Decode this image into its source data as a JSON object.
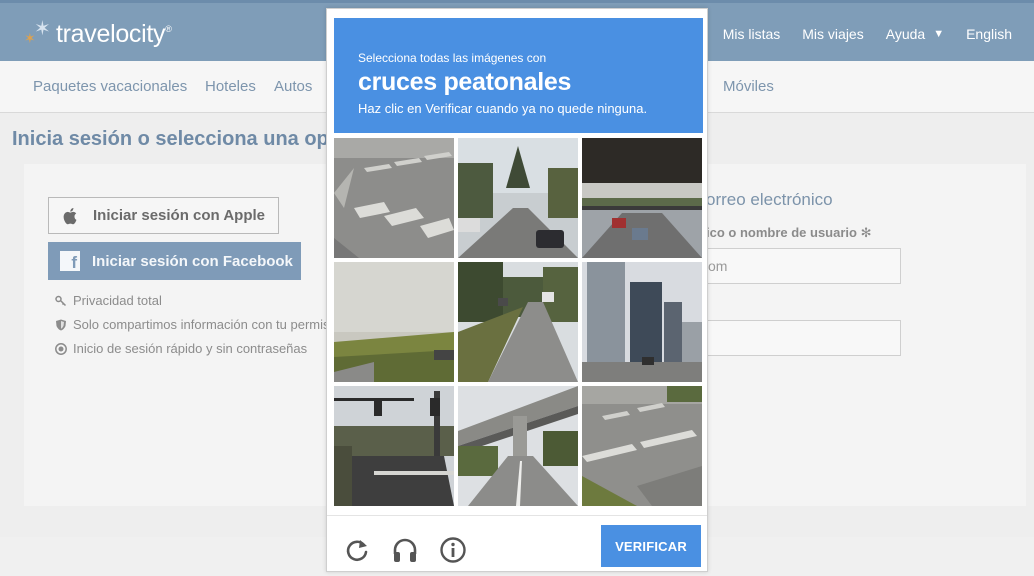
{
  "site": {
    "logo_text": "travelocity",
    "logo_tm": "®"
  },
  "topnav": {
    "items": [
      {
        "label": "Mis listas"
      },
      {
        "label": "Mis viajes"
      },
      {
        "label": "Ayuda"
      },
      {
        "label": "English"
      }
    ]
  },
  "subnav": {
    "items": [
      {
        "label": "Paquetes vacacionales"
      },
      {
        "label": "Hoteles"
      },
      {
        "label": "Autos"
      },
      {
        "label": "Móviles"
      }
    ]
  },
  "page": {
    "heading": "Inicia sesión o selecciona una op",
    "apple_button": "Iniciar sesión con Apple",
    "facebook_button": "Iniciar sesión con Facebook",
    "features": [
      {
        "icon": "key-icon",
        "label": "Privacidad total"
      },
      {
        "icon": "shield-icon",
        "label": "Solo compartimos información con tu permis"
      },
      {
        "icon": "target-icon",
        "label": "Inicio de sesión rápido y sin contraseñas"
      }
    ],
    "right_title": "orreo electrónico",
    "right_label": "ico o nombre de usuario",
    "right_label_required": "✻",
    "email_input_value": "om",
    "password_input_value": ""
  },
  "captcha": {
    "header_line1": "Selecciona todas las imágenes con",
    "header_line2": "cruces peatonales",
    "header_line3": "Haz clic en Verificar cuando ya no quede ninguna.",
    "verify_label": "VERIFICAR",
    "footer_icons": [
      "reload-icon",
      "audio-headphones-icon",
      "info-icon"
    ],
    "tiles": [
      {
        "name": "tile-1",
        "scene": "crosswalk"
      },
      {
        "name": "tile-2",
        "scene": "road-trees-cars"
      },
      {
        "name": "tile-3",
        "scene": "highway-overpass"
      },
      {
        "name": "tile-4",
        "scene": "grass-field"
      },
      {
        "name": "tile-5",
        "scene": "road-trees"
      },
      {
        "name": "tile-6",
        "scene": "city-buildings"
      },
      {
        "name": "tile-7",
        "scene": "traffic-lights-intersection"
      },
      {
        "name": "tile-8",
        "scene": "bridge-overpass"
      },
      {
        "name": "tile-9",
        "scene": "crosswalk"
      }
    ]
  },
  "colors": {
    "brand_header": "#7f9db8",
    "captcha_blue": "#4a90e2",
    "link": "#7d95ad"
  }
}
